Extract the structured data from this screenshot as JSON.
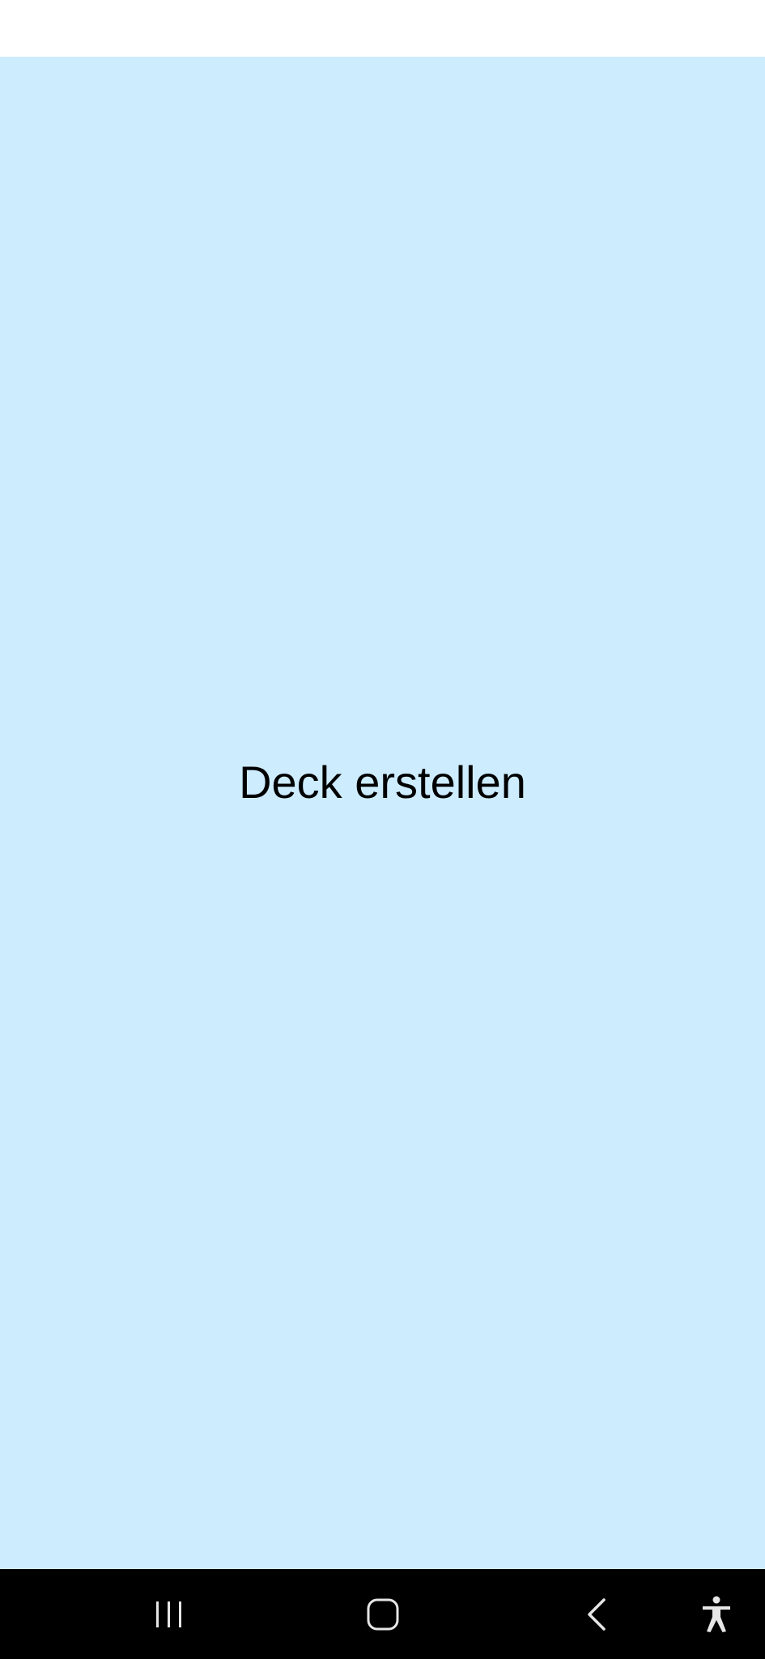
{
  "main": {
    "create_deck_label": "Deck erstellen",
    "background_color": "#cdedfe"
  },
  "status_bar": {
    "background_color": "#ffffff"
  },
  "navigation_bar": {
    "background_color": "#000000",
    "buttons": [
      {
        "icon": "recent-apps-icon"
      },
      {
        "icon": "home-icon"
      },
      {
        "icon": "back-icon"
      },
      {
        "icon": "accessibility-icon"
      }
    ]
  }
}
